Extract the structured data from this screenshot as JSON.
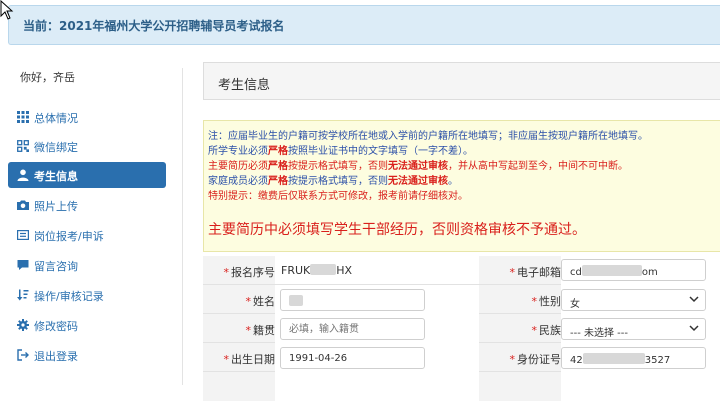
{
  "header": {
    "title": "当前：2021年福州大学公开招聘辅导员考试报名"
  },
  "sidebar": {
    "greeting": "你好，齐岳",
    "items": [
      {
        "label": "总体情况",
        "icon": "grid-icon"
      },
      {
        "label": "微信绑定",
        "icon": "qrcode-icon"
      },
      {
        "label": "考生信息",
        "icon": "user-icon",
        "active": true
      },
      {
        "label": "照片上传",
        "icon": "camera-icon"
      },
      {
        "label": "岗位报考/申诉",
        "icon": "id-card-icon"
      },
      {
        "label": "留言咨询",
        "icon": "comment-icon"
      },
      {
        "label": "操作/审核记录",
        "icon": "sort-icon"
      },
      {
        "label": "修改密码",
        "icon": "gear-icon"
      },
      {
        "label": "退出登录",
        "icon": "logout-icon"
      }
    ]
  },
  "main": {
    "panel_title": "考生信息",
    "notice": {
      "line1": "注：应届毕业生的户籍可按学校所在地或入学前的户籍所在地填写；非应届生按现户籍所在地填写。",
      "line2a": "所学专业必须",
      "line2b": "严格",
      "line2c": "按照毕业证书中的文字填写（一字不差）。",
      "line3a": "主要简历必须",
      "line3b": "严格",
      "line3c": "按提示格式填写，否则",
      "line3d": "无法通过审核",
      "line3e": "，并从高中写起到至今，中间不可中断。",
      "line4a": "家庭成员必须",
      "line4b": "严格",
      "line4c": "按提示格式填写，否则",
      "line4d": "无法通过审核",
      "line4e": "。",
      "line5": "特别提示：缴费后仅联系方式可修改，报考前请仔细核对。",
      "big_warning": "主要简历中必须填写学生干部经历，否则资格审核不予通过。"
    },
    "form": {
      "reg_no_label": "报名序号",
      "reg_no_prefix": "FRUK",
      "reg_no_suffix": "HX",
      "email_label": "电子邮箱",
      "email_prefix": "cd",
      "email_suffix": "om",
      "name_label": "姓名",
      "gender_label": "性别",
      "gender_value": "女",
      "native_label": "籍贯",
      "native_placeholder": "必填，输入籍贯",
      "ethnic_label": "民族",
      "ethnic_value": "--- 未选择 ---",
      "birth_label": "出生日期",
      "birth_value": "1991-04-26",
      "idcard_label": "身份证号",
      "idcard_prefix": "42",
      "idcard_suffix": "3527"
    }
  },
  "colors": {
    "accent": "#2a6fae",
    "danger": "#d9201c",
    "notice_bg": "#fdfde0",
    "header_bg": "#dcecf7"
  }
}
